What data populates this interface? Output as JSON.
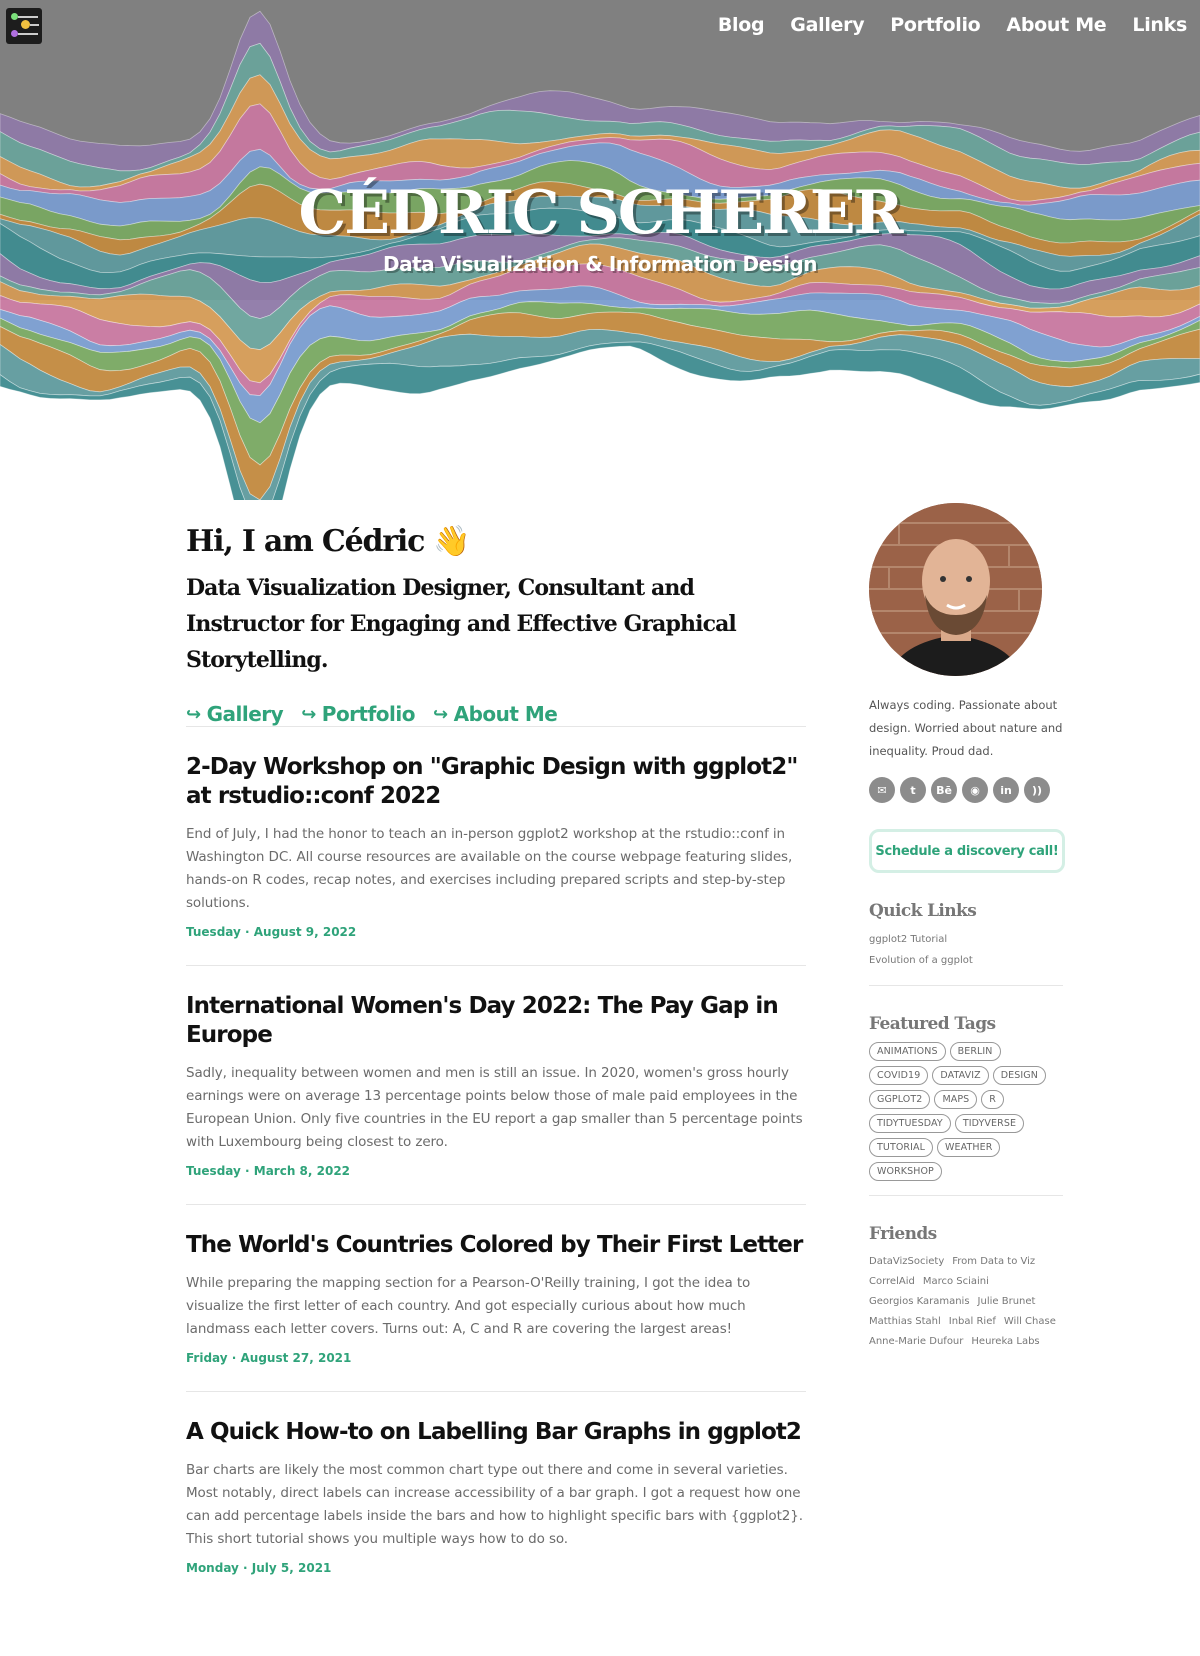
{
  "nav": {
    "items": [
      "Blog",
      "Gallery",
      "Portfolio",
      "About Me",
      "Links"
    ]
  },
  "header": {
    "title": "CÉDRIC SCHERER",
    "subtitle": "Data Visualization & Information Design",
    "colors": [
      "#8f7aa8",
      "#6aa39b",
      "#d49a55",
      "#c878a0",
      "#7a9ccf",
      "#79a862",
      "#c28a3f",
      "#5f9a9e",
      "#3f8c90"
    ]
  },
  "intro": {
    "greeting": "Hi, I am Cédric",
    "wave_emoji": "👋",
    "tagline": "Data Visualization Designer, Consultant and Instructor for Engaging and Effective Graphical Storytelling.",
    "links": [
      "Gallery",
      "Portfolio",
      "About Me"
    ]
  },
  "posts": [
    {
      "title": "2-Day Workshop on \"Graphic Design with ggplot2\" at rstudio::conf 2022",
      "summary": "End of July, I had the honor to teach an in-person ggplot2 workshop at the rstudio::conf in Washington DC. All course resources are available on the course webpage featuring slides, hands-on R codes, recap notes, and exercises including prepared scripts and step-by-step solutions.",
      "date": "Tuesday · August 9, 2022"
    },
    {
      "title": "International Women's Day 2022: The Pay Gap in Europe",
      "summary": "Sadly, inequality between women and men is still an issue. In 2020, women's gross hourly earnings were on average 13 percentage points below those of male paid employees in the European Union. Only five countries in the EU report a gap smaller than 5 percentage points with Luxembourg being closest to zero.",
      "date": "Tuesday · March 8, 2022"
    },
    {
      "title": "The World's Countries Colored by Their First Letter",
      "summary": "While preparing the mapping section for a Pearson-O'Reilly training, I got the idea to visualize the first letter of each country. And got especially curious about how much landmass each letter covers. Turns out: A, C and R are covering the largest areas!",
      "date": "Friday · August 27, 2021"
    },
    {
      "title": "A Quick How-to on Labelling Bar Graphs in ggplot2",
      "summary": "Bar charts are likely the most common chart type out there and come in several varieties. Most notably, direct labels can increase accessibility of a bar graph. I got a request how one can add percentage labels inside the bars and how to highlight specific bars with {ggplot2}. This short tutorial shows you multiple ways how to do so.",
      "date": "Monday · July 5, 2021"
    }
  ],
  "sidebar": {
    "bio": "Always coding. Passionate about design. Worried about nature and inequality. Proud dad.",
    "socials": [
      {
        "icon": "email-icon",
        "glyph": "✉"
      },
      {
        "icon": "twitter-icon",
        "glyph": "t"
      },
      {
        "icon": "behance-icon",
        "glyph": "Bē"
      },
      {
        "icon": "github-icon",
        "glyph": "◉"
      },
      {
        "icon": "linkedin-icon",
        "glyph": "in"
      },
      {
        "icon": "rss-icon",
        "glyph": "))"
      }
    ],
    "cta": "Schedule a discovery call!",
    "quick_links_title": "Quick Links",
    "quick_links": [
      "ggplot2 Tutorial",
      "Evolution of a ggplot"
    ],
    "tags_title": "Featured Tags",
    "tags": [
      "ANIMATIONS",
      "BERLIN",
      "COVID19",
      "DATAVIZ",
      "DESIGN",
      "GGPLOT2",
      "MAPS",
      "R",
      "TIDYTUESDAY",
      "TIDYVERSE",
      "TUTORIAL",
      "WEATHER",
      "WORKSHOP"
    ],
    "friends_title": "Friends",
    "friends": [
      "DataVizSociety",
      "From Data to Viz",
      "CorrelAid",
      "Marco Sciaini",
      "Georgios Karamanis",
      "Julie Brunet",
      "Matthias Stahl",
      "Inbal Rief",
      "Will Chase",
      "Anne-Marie Dufour",
      "Heureka Labs"
    ]
  },
  "accent_color": "#2fa37a"
}
